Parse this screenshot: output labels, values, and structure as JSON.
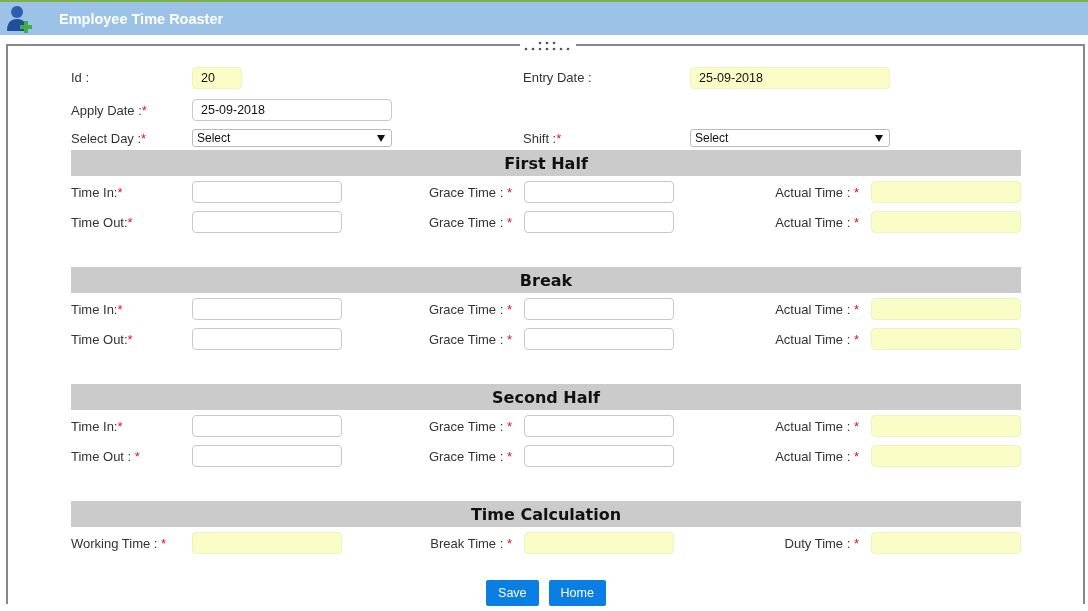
{
  "header": {
    "title": "Employee Time Roaster"
  },
  "top_rows": [
    [
      {
        "label": "Id :",
        "kind": "readonly",
        "value": "20"
      },
      {
        "label": "Entry Date :",
        "kind": "readonly",
        "value": "25-09-2018"
      }
    ],
    [
      {
        "label": "Apply Date :",
        "mark": "*",
        "kind": "text",
        "value": "25-09-2018"
      }
    ],
    [
      {
        "label": "Select Day :",
        "mark": "*",
        "kind": "select",
        "value": "Select"
      },
      {
        "label": "Shift :",
        "mark": "*",
        "kind": "select",
        "value": "Select"
      }
    ]
  ],
  "sections": [
    {
      "title": "First Half",
      "rows": [
        [
          {
            "label": "Time In:",
            "mark": "*",
            "kind": "text"
          },
          {
            "label": "Grace Time : ",
            "mark": "*",
            "kind": "text"
          },
          {
            "label": "Actual Time : ",
            "mark": "*",
            "kind": "readonly"
          }
        ],
        [
          {
            "label": "Time Out:",
            "mark": "*",
            "kind": "text"
          },
          {
            "label": "Grace Time : ",
            "mark": "*",
            "kind": "text"
          },
          {
            "label": "Actual Time : ",
            "mark": "*",
            "kind": "readonly"
          }
        ]
      ]
    },
    {
      "title": "Break",
      "rows": [
        [
          {
            "label": "Time In:",
            "mark": "*",
            "kind": "text"
          },
          {
            "label": "Grace Time : ",
            "mark": "*",
            "kind": "text"
          },
          {
            "label": "Actual Time : ",
            "mark": "*",
            "kind": "readonly"
          }
        ],
        [
          {
            "label": "Time Out:",
            "mark": "*",
            "kind": "text"
          },
          {
            "label": "Grace Time : ",
            "mark": "*",
            "kind": "text"
          },
          {
            "label": "Actual Time : ",
            "mark": "*",
            "kind": "readonly"
          }
        ]
      ]
    },
    {
      "title": "Second Half",
      "rows": [
        [
          {
            "label": "Time In:",
            "mark": "*",
            "kind": "text"
          },
          {
            "label": "Grace Time : ",
            "mark": "*",
            "kind": "text"
          },
          {
            "label": "Actual Time : ",
            "mark": "*",
            "kind": "readonly"
          }
        ],
        [
          {
            "label": "Time Out : ",
            "mark": "*",
            "kind": "text"
          },
          {
            "label": "Grace Time : ",
            "mark": "*",
            "kind": "text"
          },
          {
            "label": "Actual Time : ",
            "mark": "*",
            "kind": "readonly"
          }
        ]
      ]
    },
    {
      "title": "Time Calculation",
      "rows": [
        [
          {
            "label": "Working Time : ",
            "mark": "*",
            "kind": "readonly"
          },
          {
            "label": "Break Time : ",
            "mark": "*",
            "kind": "readonly"
          },
          {
            "label": "Duty Time : ",
            "mark": "*",
            "kind": "readonly"
          }
        ]
      ]
    }
  ],
  "buttons": [
    "Save",
    "Home"
  ]
}
